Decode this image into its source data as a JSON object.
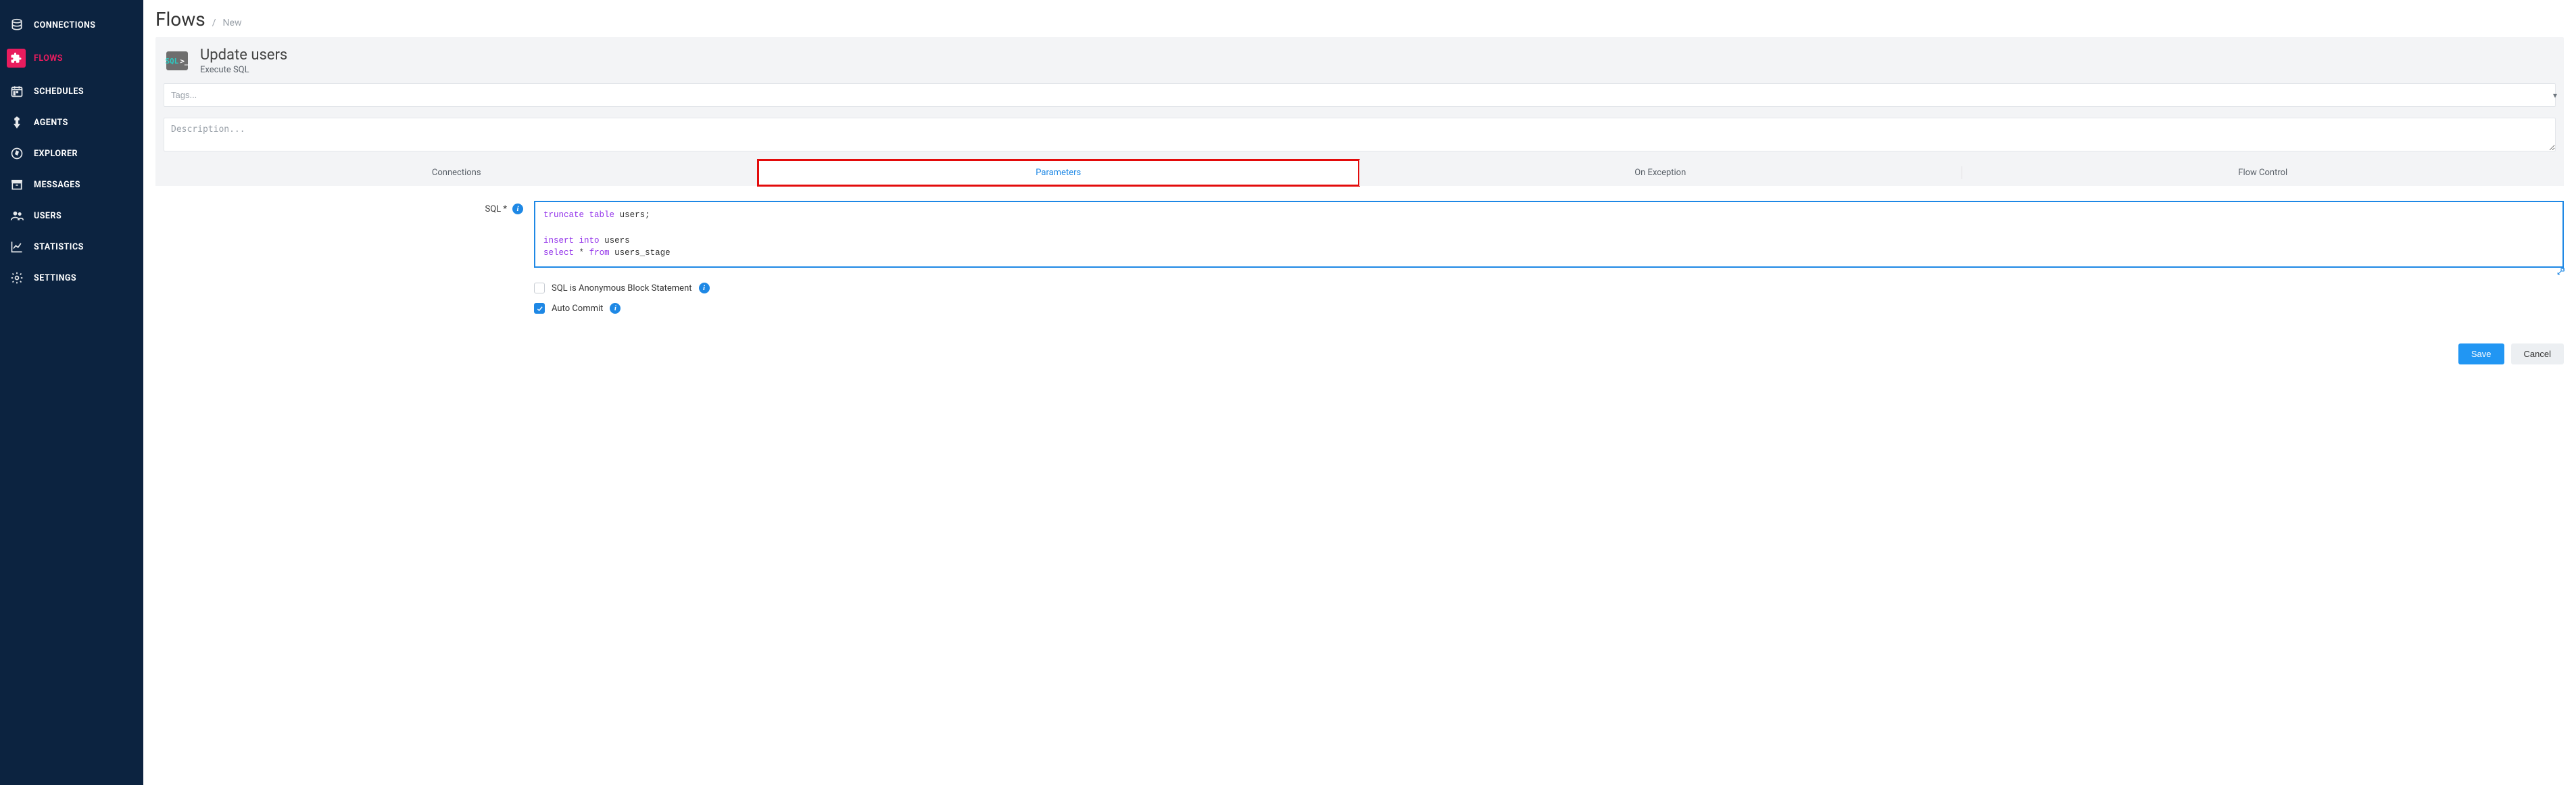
{
  "sidebar": {
    "items": [
      {
        "label": "CONNECTIONS",
        "icon": "database-icon"
      },
      {
        "label": "FLOWS",
        "icon": "puzzle-icon",
        "active": true
      },
      {
        "label": "SCHEDULES",
        "icon": "calendar-icon"
      },
      {
        "label": "AGENTS",
        "icon": "agent-icon"
      },
      {
        "label": "EXPLORER",
        "icon": "compass-icon"
      },
      {
        "label": "MESSAGES",
        "icon": "archive-icon"
      },
      {
        "label": "USERS",
        "icon": "users-icon"
      },
      {
        "label": "STATISTICS",
        "icon": "chart-icon"
      },
      {
        "label": "SETTINGS",
        "icon": "gear-icon"
      }
    ]
  },
  "breadcrumb": {
    "root": "Flows",
    "sep": "/",
    "leaf": "New"
  },
  "flow": {
    "badge": "SQL",
    "badge_suffix": ">_",
    "title": "Update users",
    "subtitle": "Execute SQL",
    "tags_placeholder": "Tags...",
    "description_placeholder": "Description..."
  },
  "tabs": {
    "items": [
      {
        "label": "Connections"
      },
      {
        "label": "Parameters",
        "active": true,
        "highlighted": true
      },
      {
        "label": "On Exception"
      },
      {
        "label": "Flow Control"
      }
    ]
  },
  "form": {
    "sql_label": "SQL *",
    "sql_tokens": [
      [
        "kw",
        "truncate"
      ],
      [
        "sp",
        " "
      ],
      [
        "kw",
        "table"
      ],
      [
        "sp",
        " "
      ],
      [
        "id",
        "users;"
      ],
      [
        "nl"
      ],
      [
        "nl"
      ],
      [
        "kw",
        "insert"
      ],
      [
        "sp",
        " "
      ],
      [
        "kw",
        "into"
      ],
      [
        "sp",
        " "
      ],
      [
        "id",
        "users"
      ],
      [
        "nl"
      ],
      [
        "kw",
        "select"
      ],
      [
        "sp",
        " "
      ],
      [
        "id",
        "*"
      ],
      [
        "sp",
        " "
      ],
      [
        "kw",
        "from"
      ],
      [
        "sp",
        " "
      ],
      [
        "id",
        "users_stage"
      ]
    ],
    "anon_label": "SQL is Anonymous Block Statement",
    "anon_checked": false,
    "autocommit_label": "Auto Commit",
    "autocommit_checked": true
  },
  "footer": {
    "save": "Save",
    "cancel": "Cancel"
  }
}
